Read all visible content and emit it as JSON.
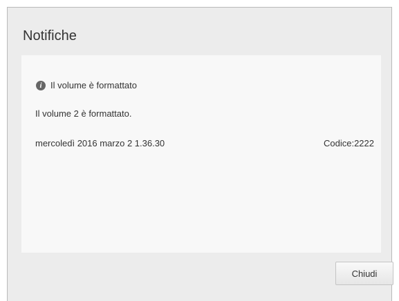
{
  "dialog": {
    "title": "Notifiche",
    "close_label": "Chiudi"
  },
  "notification": {
    "icon": "info-icon",
    "heading": "Il volume è formattato",
    "message": "Il volume 2 è formattato.",
    "date": "mercoledì 2016 marzo 2 1.36.30",
    "code": "Codice:2222"
  }
}
